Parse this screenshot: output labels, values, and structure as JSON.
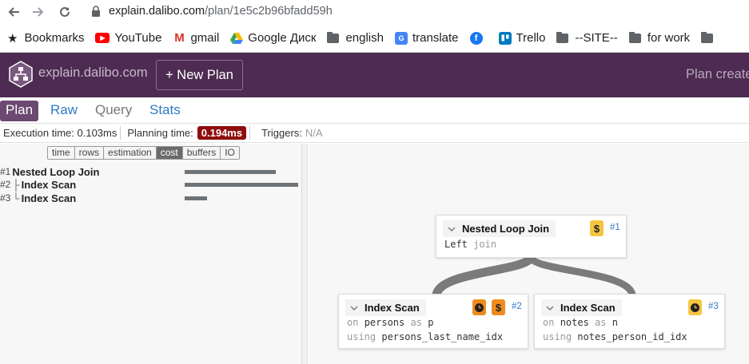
{
  "browser": {
    "url_host": "explain.dalibo.com",
    "url_path": "/plan/1e5c2b96bfadd59h",
    "bookmarks": [
      {
        "label": "Bookmarks",
        "icon": "star-icon"
      },
      {
        "label": "YouTube",
        "icon": "youtube-icon"
      },
      {
        "label": "gmail",
        "icon": "gmail-icon"
      },
      {
        "label": "Google Диск",
        "icon": "google-drive-icon"
      },
      {
        "label": "english",
        "icon": "folder-icon"
      },
      {
        "label": "translate",
        "icon": "translate-icon"
      },
      {
        "label": "",
        "icon": "facebook-icon"
      },
      {
        "label": "Trello",
        "icon": "trello-icon"
      },
      {
        "label": "--SITE--",
        "icon": "folder-icon"
      },
      {
        "label": "for work",
        "icon": "folder-icon"
      }
    ]
  },
  "header": {
    "brand": "explain.dalibo.com",
    "new_plan": "+ New Plan",
    "plan_created": "Plan created",
    "color": "#4d2b52"
  },
  "tabs": [
    {
      "label": "Plan",
      "active": true
    },
    {
      "label": "Raw",
      "active": false
    },
    {
      "label": "Query",
      "active": false
    },
    {
      "label": "Stats",
      "active": false
    }
  ],
  "status": {
    "execution_label": "Execution time:",
    "execution_value": "0.103ms",
    "planning_label": "Planning time:",
    "planning_value": "0.194ms",
    "triggers_label": "Triggers:",
    "triggers_value": "N/A"
  },
  "metrics": [
    "time",
    "rows",
    "estimation",
    "cost",
    "buffers",
    "IO"
  ],
  "active_metric": "cost",
  "nodes": [
    {
      "num": "#1",
      "tree": "",
      "name": "Nested Loop Join",
      "cost_fraction": 0.8
    },
    {
      "num": "#2",
      "tree": "├",
      "name": "Index Scan",
      "cost_fraction": 1.0
    },
    {
      "num": "#3",
      "tree": "└",
      "name": "Index Scan",
      "cost_fraction": 0.2
    }
  ],
  "diagram": {
    "root": {
      "title": "Nested Loop Join",
      "num": "#1",
      "sub_value": "Left",
      "sub_kw": "join",
      "icons": [
        "dollar-icon"
      ]
    },
    "left": {
      "title": "Index Scan",
      "num": "#2",
      "on_kw": "on",
      "relation": "persons",
      "as_kw": "as",
      "alias": "p",
      "using_kw": "using",
      "index": "persons_last_name_idx",
      "icons": [
        "clock-icon",
        "dollar-icon"
      ]
    },
    "right": {
      "title": "Index Scan",
      "num": "#3",
      "on_kw": "on",
      "relation": "notes",
      "as_kw": "as",
      "alias": "n",
      "using_kw": "using",
      "index": "notes_person_id_idx",
      "icons": [
        "clock-icon"
      ]
    }
  }
}
